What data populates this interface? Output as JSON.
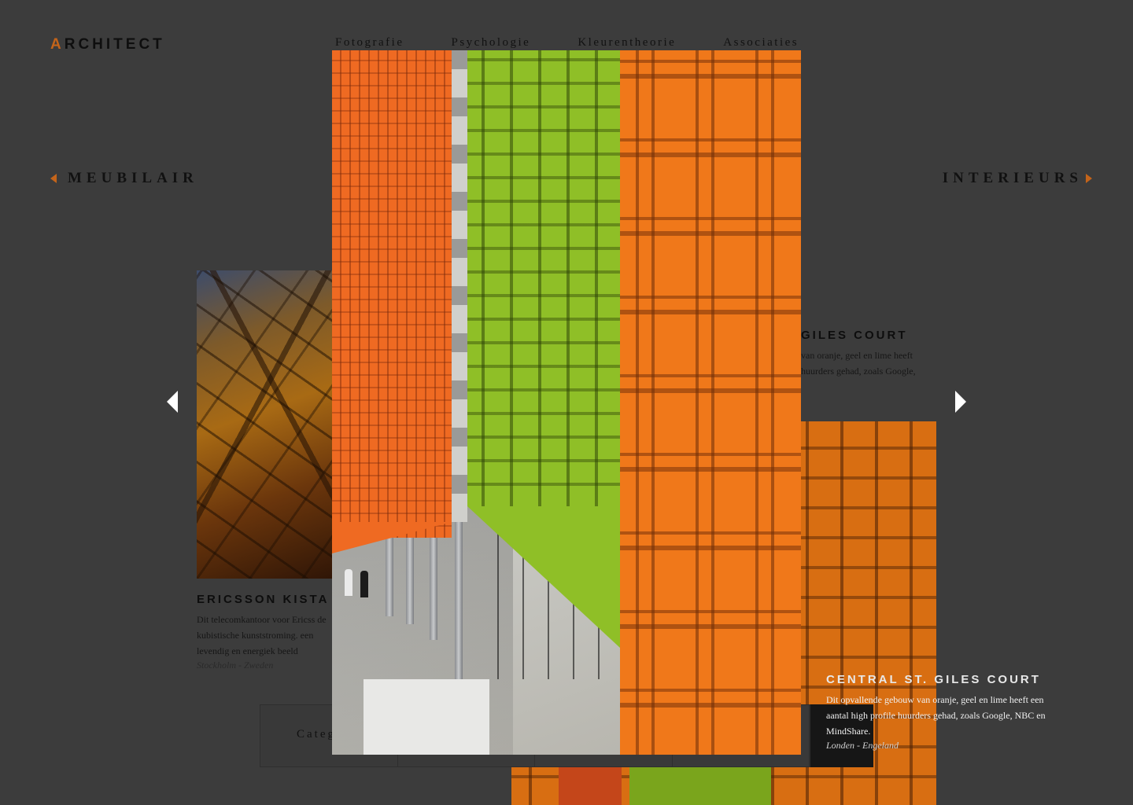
{
  "logo": {
    "first_letter": "A",
    "rest": "RCHITECT"
  },
  "nav": {
    "items": [
      {
        "label": "Fotografie"
      },
      {
        "label": "Psychologie"
      },
      {
        "label": "Kleurentheorie"
      },
      {
        "label": "Associaties"
      }
    ]
  },
  "sections": {
    "prev_label": "MEUBILAIR",
    "next_label": "INTERIEURS"
  },
  "cards": [
    {
      "title": "ERICSSON KISTA",
      "description": "Dit telecomkantoor voor Ericss de kubistische kunststroming. een levendig en energiek beeld",
      "location": "Stockholm - Zweden"
    },
    {
      "title_partial": "GILES COURT",
      "description_partial": "van oranje, geel en lime heeft huurders gehad, zoals Google,"
    },
    {
      "title": "CENTRAL ST. GILES COURT",
      "description": "Dit opvallende gebouw van oranje, geel en lime heeft een aantal high profile huurders gehad, zoals Google, NBC en MindShare.",
      "location": "Londen - Engeland"
    }
  ],
  "category": {
    "label": "Categ"
  },
  "colors": {
    "accent": "#c4641a",
    "background": "#3c3c3c",
    "lime": "#8fbf27",
    "orange": "#f0781a"
  }
}
